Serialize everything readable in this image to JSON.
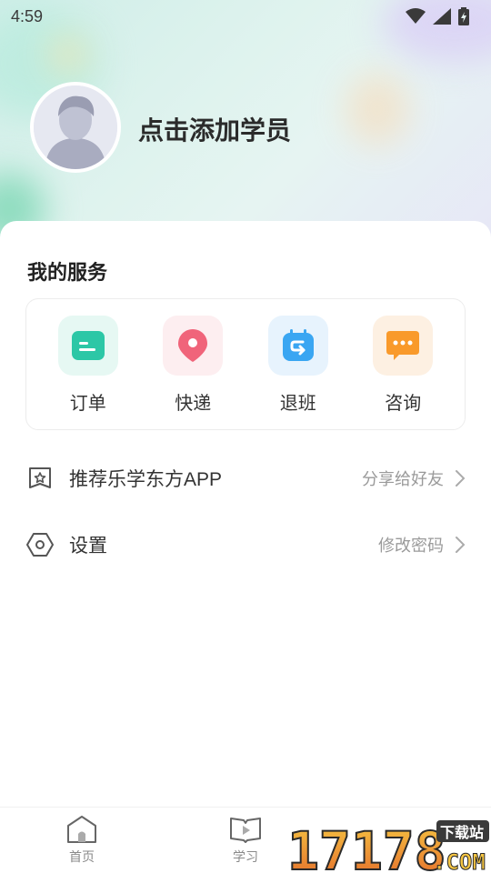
{
  "status_bar": {
    "time": "4:59"
  },
  "profile": {
    "name": "点击添加学员"
  },
  "services": {
    "title": "我的服务",
    "items": [
      {
        "label": "订单",
        "icon": "order-icon",
        "color": "#2cc7a6"
      },
      {
        "label": "快递",
        "icon": "location-pin-icon",
        "color": "#f0647a"
      },
      {
        "label": "退班",
        "icon": "calendar-return-icon",
        "color": "#3aa6f2"
      },
      {
        "label": "咨询",
        "icon": "chat-bubble-icon",
        "color": "#f99a2b"
      }
    ]
  },
  "menu": [
    {
      "label": "推荐乐学东方APP",
      "hint": "分享给好友",
      "icon": "star-badge-icon"
    },
    {
      "label": "设置",
      "hint": "修改密码",
      "icon": "hexagon-settings-icon"
    }
  ],
  "tabbar": {
    "tabs": [
      {
        "label": "首页",
        "icon": "home-icon"
      },
      {
        "label": "学习",
        "icon": "play-book-icon"
      }
    ]
  },
  "watermark": {
    "digits": "17178",
    "badge": "下载站",
    "suffix": ".COM"
  }
}
